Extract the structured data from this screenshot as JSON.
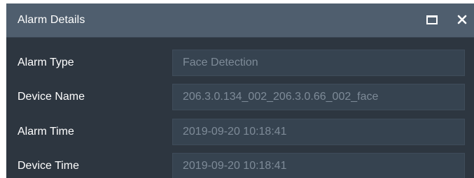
{
  "dialog": {
    "title": "Alarm Details",
    "maximize_icon": "maximize-icon",
    "close_icon": "close-icon",
    "close_glyph": "✕"
  },
  "fields": [
    {
      "label": "Alarm Type",
      "value": "Face Detection"
    },
    {
      "label": "Device Name",
      "value": "206.3.0.134_002_206.3.0.66_002_face"
    },
    {
      "label": "Alarm Time",
      "value": "2019-09-20 10:18:41"
    },
    {
      "label": "Device Time",
      "value": "2019-09-20 10:18:41"
    }
  ],
  "colors": {
    "titlebar": "#4f5e6e",
    "body": "#2d3640",
    "field_bg": "#364350",
    "label_text": "#ffffff",
    "value_text": "#7e8b98"
  }
}
